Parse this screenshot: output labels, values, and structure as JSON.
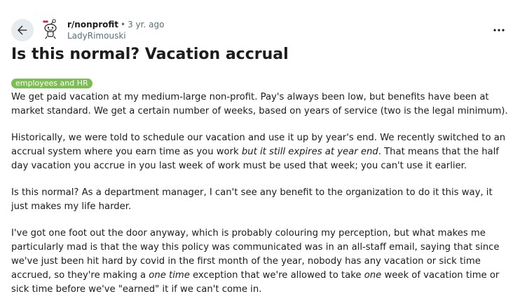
{
  "post": {
    "subreddit": "r/nonprofit",
    "separator": "•",
    "time_ago": "3 yr. ago",
    "author": "LadyRimouski",
    "title": "Is this normal? Vacation accrual",
    "flair": "employees and HR",
    "flair_color": "#7cbd54",
    "paragraphs": [
      [
        {
          "text": "We get paid vacation at my medium-large non-profit. Pay's always been low, but benefits have been at market standard. We get a certain number of weeks, based on years of service (two is the legal minimum).",
          "italic": false
        }
      ],
      [
        {
          "text": "Historically, we were told to schedule our vacation and use it up by year's end. We recently switched to an accrual system where you earn time as you work ",
          "italic": false
        },
        {
          "text": "but it still expires at year end",
          "italic": true
        },
        {
          "text": ". That means that the half day vacation you accrue in you last week of work must be used that week; you can't use it earlier.",
          "italic": false
        }
      ],
      [
        {
          "text": "Is this normal? As a department manager, I can't see any benefit to the organization to do it this way, it just makes my life harder.",
          "italic": false
        }
      ],
      [
        {
          "text": "I've got one foot out the door anyway, which is probably colouring my perception, but what makes me particularly mad is that the way this policy was communicated was in an all-staff email, saying that since we've just been hit hard by covid in the first month of the year, nobody has any vacation or sick time accrued, so they're making a ",
          "italic": false
        },
        {
          "text": "one time",
          "italic": true
        },
        {
          "text": " exception that we're allowed to take ",
          "italic": false
        },
        {
          "text": "one",
          "italic": true
        },
        {
          "text": " week of vacation time or sick time before we've \"earned\" it if we can't come in.",
          "italic": false
        }
      ]
    ]
  },
  "icons": {
    "back": "arrow-left-icon",
    "avatar": "snoo-avatar-icon",
    "more": "more-horizontal-icon"
  },
  "colors": {
    "text": "#1c1c1c",
    "meta": "#576f76",
    "back_button_bg": "#e5ebee"
  }
}
